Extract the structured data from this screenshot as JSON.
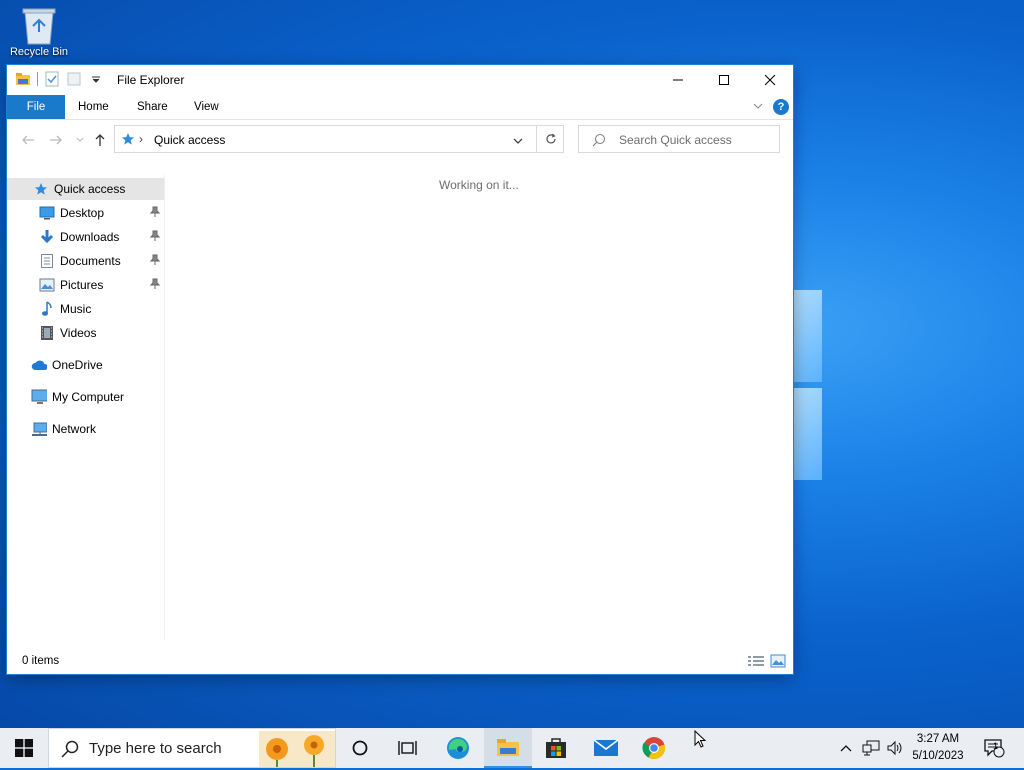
{
  "desktop": {
    "recycle_bin_label": "Recycle Bin"
  },
  "window": {
    "title": "File Explorer",
    "ribbon_tabs": [
      "File",
      "Home",
      "Share",
      "View"
    ],
    "help_label": "?",
    "address": {
      "location": "Quick access"
    },
    "search": {
      "placeholder": "Search Quick access"
    },
    "nav": {
      "quick_access": "Quick access",
      "pinned": [
        {
          "label": "Desktop",
          "icon": "desktop-icon",
          "pinned": true
        },
        {
          "label": "Downloads",
          "icon": "downloads-icon",
          "pinned": true
        },
        {
          "label": "Documents",
          "icon": "documents-icon",
          "pinned": true
        },
        {
          "label": "Pictures",
          "icon": "pictures-icon",
          "pinned": true
        },
        {
          "label": "Music",
          "icon": "music-icon",
          "pinned": false
        },
        {
          "label": "Videos",
          "icon": "videos-icon",
          "pinned": false
        }
      ],
      "onedrive": "OneDrive",
      "my_computer": "My Computer",
      "network": "Network"
    },
    "content_message": "Working on it...",
    "status": {
      "item_count": "0 items"
    }
  },
  "taskbar": {
    "search_text": "Type here to search",
    "apps": [
      "cortana-icon",
      "task-view-icon",
      "edge-icon",
      "file-explorer-icon",
      "store-icon",
      "mail-icon",
      "chrome-icon"
    ],
    "clock": {
      "time": "3:27 AM",
      "date": "5/10/2023"
    },
    "notification_count": "1"
  },
  "colors": {
    "accent": "#1979ca",
    "desktop_blue": "#0a62cc"
  }
}
